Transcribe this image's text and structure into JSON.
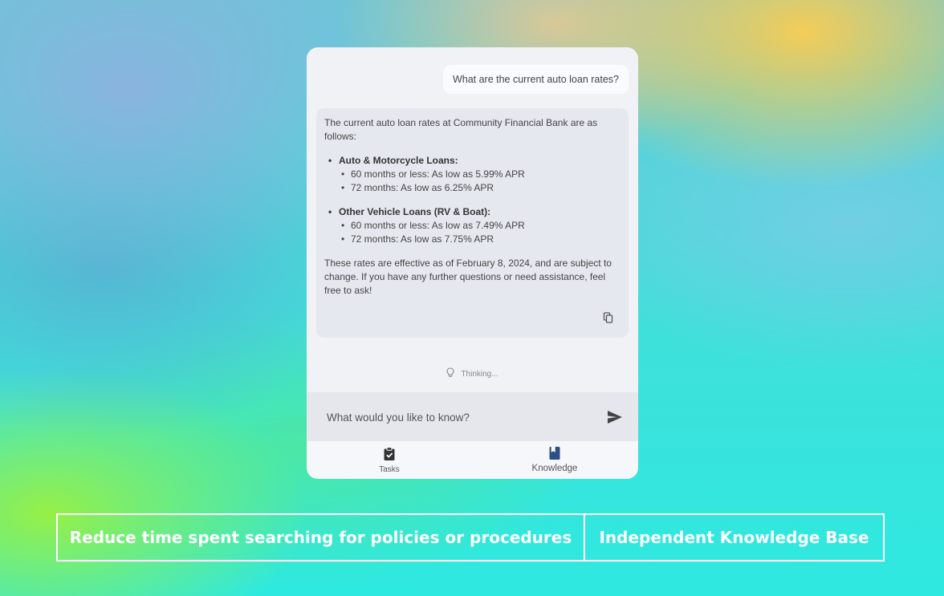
{
  "chat": {
    "user_message": "What are the current auto loan rates?",
    "assistant": {
      "intro": "The current auto loan rates at Community Financial Bank are as follows:",
      "sections": [
        {
          "heading": "Auto & Motorcycle Loans:",
          "items": [
            "60 months or less: As low as 5.99% APR",
            "72 months: As low as 6.25% APR"
          ]
        },
        {
          "heading": "Other Vehicle Loans (RV & Boat):",
          "items": [
            "60 months or less: As low as 7.49% APR",
            "72 months: As low as 7.75% APR"
          ]
        }
      ],
      "footnote": "These rates are effective as of February 8, 2024, and are subject to change. If you have any further questions or need assistance, feel free to ask!",
      "copy_icon": "copy-icon"
    },
    "status": {
      "icon": "lightbulb-icon",
      "text": "Thinking..."
    },
    "composer": {
      "placeholder": "What would you like to know?",
      "send_icon": "send-icon"
    }
  },
  "tabs": [
    {
      "label": "Tasks",
      "icon": "task-clipboard-icon"
    },
    {
      "label": "Knowledge",
      "icon": "book-icon"
    }
  ],
  "captions": {
    "left": "Reduce time spent searching for policies or procedures",
    "right": "Independent Knowledge Base"
  },
  "colors": {
    "panel_bg": "#f1f2f6",
    "assistant_bg": "#e6e8ef",
    "knowledge_icon": "#2b4f86",
    "caption_text": "#ffffff"
  }
}
